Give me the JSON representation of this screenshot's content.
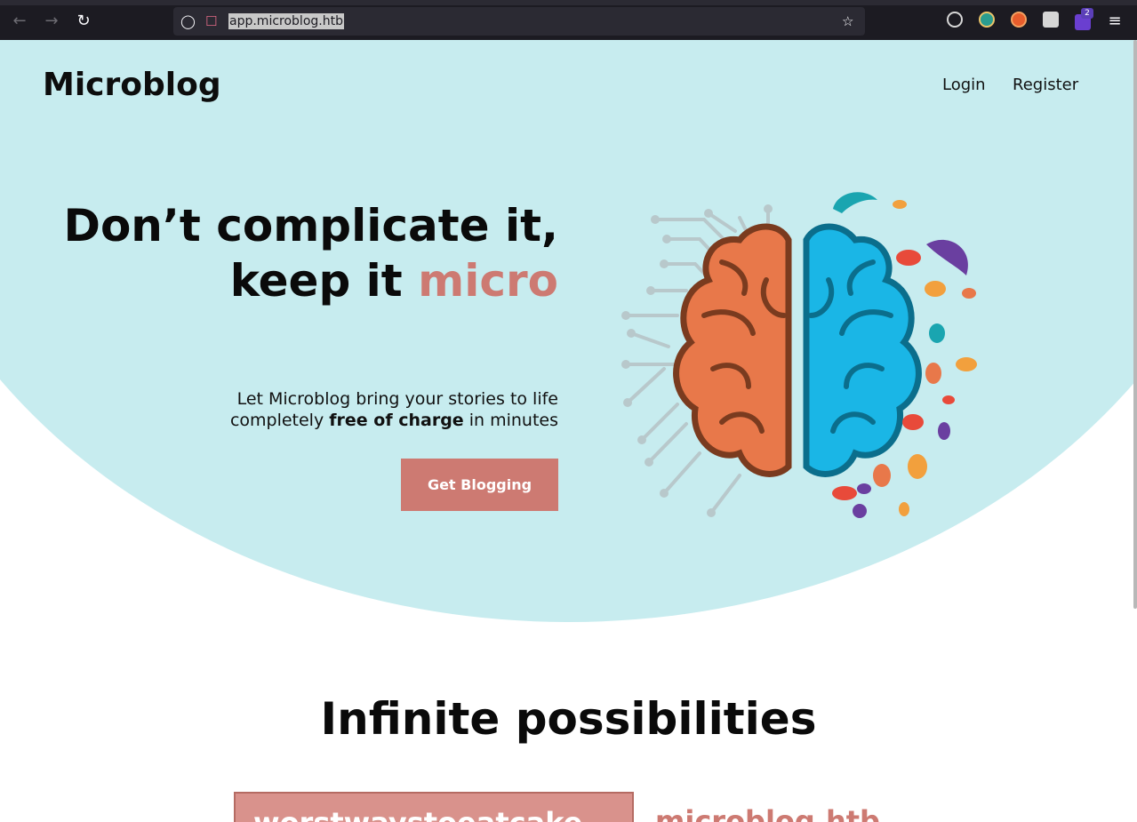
{
  "browser": {
    "url": "app.microblog.htb",
    "extension_badge": "2",
    "icons": [
      "back-icon",
      "forward-icon",
      "reload-icon",
      "shield-icon",
      "lock-icon",
      "star-icon",
      "cookie-icon",
      "glasses-icon",
      "fox-icon",
      "cards-icon",
      "bookmark-icon",
      "menu-icon"
    ]
  },
  "header": {
    "logo": "Microblog",
    "nav": {
      "login": "Login",
      "register": "Register"
    }
  },
  "hero": {
    "headline_line1": "Don’t complicate it,",
    "headline_line2_plain": "keep it ",
    "headline_line2_accent": "micro",
    "sub_line1": "Let Microblog bring your stories to life",
    "sub_line2_pre": "completely ",
    "sub_line2_bold": "free of charge",
    "sub_line2_post": " in minutes",
    "cta": "Get Blogging",
    "illustration": "brain-icon"
  },
  "section": {
    "title": "Infinite possibilities",
    "blogs": [
      "worstwaystoeatcake",
      "microblog.htb"
    ]
  },
  "colors": {
    "hero_bg": "#c7ecef",
    "accent": "#cd7a72",
    "chrome": "#1c1b22",
    "brain_left": "#e8784a",
    "brain_right": "#1ab6e6"
  }
}
